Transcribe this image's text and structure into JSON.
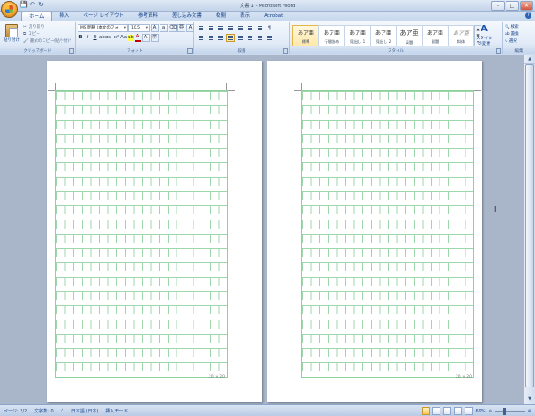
{
  "window": {
    "title": "文書 1 - Microsoft Word",
    "buttons": {
      "minimize": "–",
      "maximize": "□",
      "close": "✕"
    }
  },
  "qat": {
    "save_icon": "💾",
    "undo_icon": "↶",
    "redo_icon": "↻"
  },
  "tabs": [
    "ホーム",
    "挿入",
    "ページ レイアウト",
    "参考資料",
    "差し込み文書",
    "校閲",
    "表示",
    "Acrobat"
  ],
  "clipboard": {
    "paste": "貼り付け",
    "cut": "切り取り",
    "copy": "コピー",
    "format_painter": "書式のコピー/貼り付け",
    "group": "クリップボード"
  },
  "font": {
    "name": "MS 明朝 (本文のフォ",
    "size": "10.5",
    "group": "フォント"
  },
  "paragraph": {
    "group": "段落"
  },
  "styles": {
    "group": "スタイル",
    "items": [
      {
        "sample": "あア亜",
        "name": "標準"
      },
      {
        "sample": "あア亜",
        "name": "行間詰め"
      },
      {
        "sample": "あア亜",
        "name": "見出し 1"
      },
      {
        "sample": "あア亜",
        "name": "見出し 2"
      },
      {
        "sample": "あア亜",
        "name": "表題"
      },
      {
        "sample": "あア亜",
        "name": "副題"
      },
      {
        "sample": "あア亜",
        "name": "斜体"
      }
    ],
    "change_label": "スタイルの変更"
  },
  "editing": {
    "group": "編集",
    "find": "検索",
    "replace": "置換",
    "select": "選択"
  },
  "pages": [
    {
      "footer": "20 × 20"
    },
    {
      "footer": "20 × 20"
    }
  ],
  "status": {
    "page": "ページ: 2/2",
    "words": "文字数: 0",
    "language": "日本語 (日本)",
    "mode": "挿入モード",
    "zoom": "69%",
    "zoom_level": 0.69
  }
}
